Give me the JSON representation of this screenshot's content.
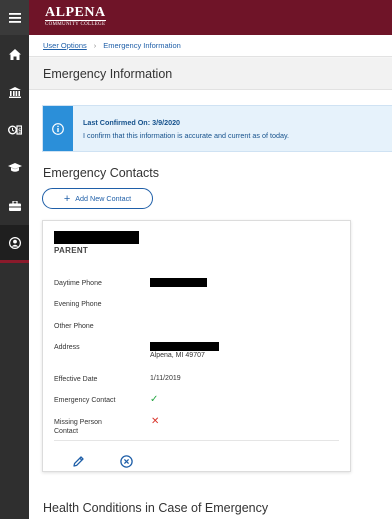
{
  "brand": {
    "name": "ALPENA",
    "subtitle": "COMMUNITY COLLEGE"
  },
  "sidebar": {
    "items": [
      {
        "icon": "menu-icon"
      },
      {
        "icon": "home-icon"
      },
      {
        "icon": "bank-icon"
      },
      {
        "icon": "finance-icon"
      },
      {
        "icon": "graduation-cap-icon"
      },
      {
        "icon": "briefcase-icon"
      },
      {
        "icon": "user-profile-icon",
        "active": true
      }
    ]
  },
  "breadcrumb": {
    "parent": "User Options",
    "separator": "›",
    "current": "Emergency Information"
  },
  "page_title": "Emergency Information",
  "alert": {
    "line1": "Last Confirmed On: 3/9/2020",
    "line2": "I confirm that this information is accurate and current as of today."
  },
  "emergency_contacts": {
    "title": "Emergency Contacts",
    "add_button": "Add New Contact",
    "card": {
      "relationship": "PARENT",
      "labels": {
        "daytime_phone": "Daytime Phone",
        "evening_phone": "Evening Phone",
        "other_phone": "Other Phone",
        "address": "Address",
        "effective_date": "Effective Date",
        "emergency_contact": "Emergency Contact",
        "missing_person": "Missing Person Contact"
      },
      "values": {
        "address_city": "Alpena, MI 49707",
        "effective_date": "1/11/2019"
      },
      "emergency_contact_icon": "check-icon",
      "missing_person_icon": "x-icon"
    }
  },
  "health": {
    "title": "Health Conditions in Case of Emergency"
  },
  "colors": {
    "header": "#6f1428",
    "sidebar": "#2f2f2f",
    "link": "#1f5fa8",
    "alert_accent": "#2b8fd9",
    "check": "#28a745",
    "x": "#d9342b"
  }
}
